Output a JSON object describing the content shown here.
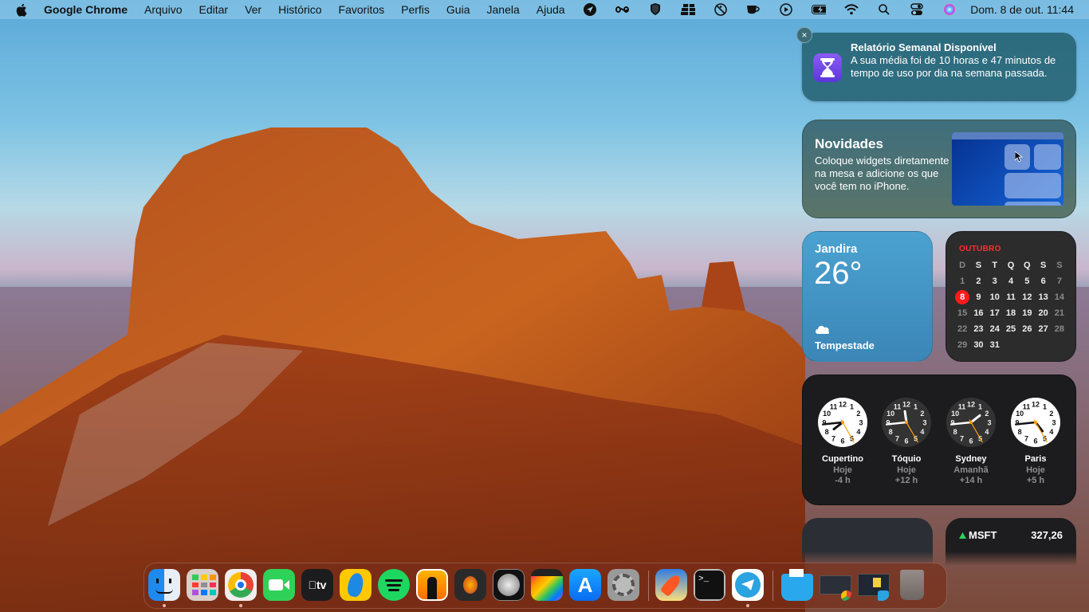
{
  "menubar": {
    "app_name": "Google Chrome",
    "menus": [
      "Arquivo",
      "Editar",
      "Ver",
      "Histórico",
      "Favoritos",
      "Perfis",
      "Guia",
      "Janela",
      "Ajuda"
    ],
    "status_icons": [
      "location-arrow-icon",
      "infinity-icon",
      "shield-icon",
      "tray-icon",
      "accessibility-off-icon",
      "coffee-cup-icon",
      "play-circle-icon",
      "battery-charging-icon",
      "wifi-icon",
      "search-icon",
      "control-center-icon",
      "siri-icon"
    ],
    "datetime": "Dom. 8 de out.  11:44"
  },
  "notification": {
    "title": "Relatório Semanal Disponível",
    "body": "A sua média foi de 10 horas e 47 minutos de tempo de uso por dia na semana passada.",
    "icon": "hourglass-icon",
    "close_label": "×"
  },
  "novidades": {
    "title": "Novidades",
    "description": "Coloque widgets diretamente na mesa e adicione os que você tem no iPhone."
  },
  "weather": {
    "city": "Jandira",
    "temperature": "26°",
    "condition": "Tempestade",
    "icon": "cloud-icon"
  },
  "calendar": {
    "month": "OUTUBRO",
    "weekdays": [
      "D",
      "S",
      "T",
      "Q",
      "Q",
      "S",
      "S"
    ],
    "leading_blanks": 0,
    "days": 31,
    "today": 8
  },
  "world_clock": [
    {
      "city": "Cupertino",
      "day": "Hoje",
      "offset": "-4 h",
      "time": "07:44",
      "theme": "light"
    },
    {
      "city": "Tóquio",
      "day": "Hoje",
      "offset": "+12 h",
      "time": "23:44",
      "theme": "dark"
    },
    {
      "city": "Sydney",
      "day": "Amanhã",
      "offset": "+14 h",
      "time": "01:44",
      "theme": "dark"
    },
    {
      "city": "Paris",
      "day": "Hoje",
      "offset": "+5 h",
      "time": "16:44",
      "theme": "light"
    }
  ],
  "stocks": {
    "symbol": "MSFT",
    "price": "327,26",
    "trend": "up",
    "up_color": "#30d158"
  },
  "dock": {
    "apps": [
      {
        "name": "Finder",
        "running": true
      },
      {
        "name": "Launchpad",
        "running": false
      },
      {
        "name": "Google Chrome",
        "running": true
      },
      {
        "name": "FaceTime",
        "running": false
      },
      {
        "name": "Apple TV",
        "running": false
      },
      {
        "name": "Rosetta Stone",
        "running": false
      },
      {
        "name": "Spotify",
        "running": false
      },
      {
        "name": "GarageBand Lessons",
        "running": false
      },
      {
        "name": "GarageBand",
        "running": false
      },
      {
        "name": "Logic Pro",
        "running": false
      },
      {
        "name": "Final Cut Pro",
        "running": false
      },
      {
        "name": "App Store",
        "running": false
      },
      {
        "name": "System Settings",
        "running": false
      }
    ],
    "recent": [
      {
        "name": "Rocket Typist",
        "running": false
      },
      {
        "name": "Terminal",
        "running": false
      },
      {
        "name": "Telegram",
        "running": true
      }
    ],
    "stacks": [
      {
        "name": "Downloads Folder"
      },
      {
        "name": "Chrome Window"
      },
      {
        "name": "Telegram Window"
      },
      {
        "name": "Trash"
      }
    ],
    "tv_label": "tv"
  }
}
